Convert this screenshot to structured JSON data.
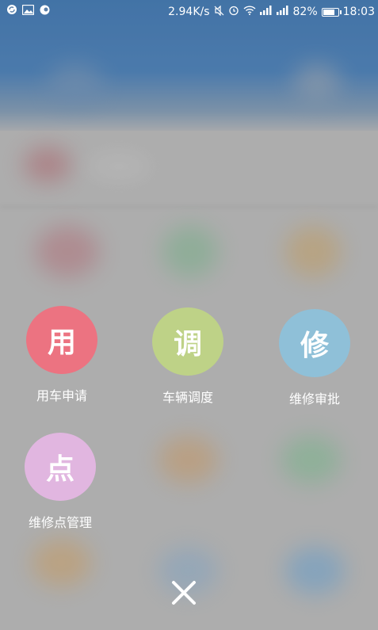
{
  "status_bar": {
    "speed": "2.94K/s",
    "battery": "82%",
    "battery_level": 0.82,
    "time": "18:03",
    "left_icons": [
      "sync-icon",
      "image-icon",
      "cloud-icon"
    ],
    "right_icons": [
      "mute-icon",
      "alarm-icon",
      "wifi-icon",
      "signal-icon",
      "signal-icon",
      "battery-icon"
    ]
  },
  "menu": {
    "items": [
      {
        "glyph": "用",
        "label": "用车申请",
        "color": "#ec7381"
      },
      {
        "glyph": "调",
        "label": "车辆调度",
        "color": "#bed287"
      },
      {
        "glyph": "修",
        "label": "维修审批",
        "color": "#8fc0d8"
      },
      {
        "glyph": "点",
        "label": "维修点管理",
        "color": "#e1b6e0"
      }
    ]
  },
  "close": {
    "icon": "close-icon"
  }
}
